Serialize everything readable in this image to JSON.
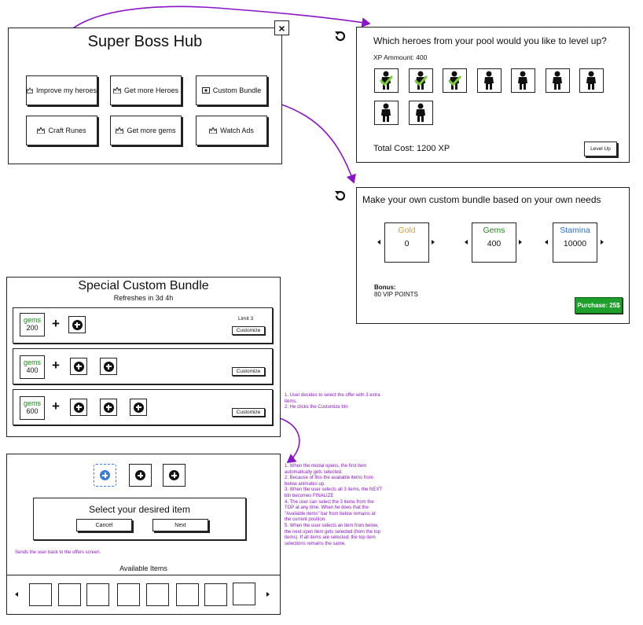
{
  "hub": {
    "title": "Super Boss Hub",
    "close_label": "×",
    "buttons": [
      {
        "label": "Improve my heroes"
      },
      {
        "label": "Get more Heroes"
      },
      {
        "label": "Custom Bundle"
      },
      {
        "label": "Craft Runes"
      },
      {
        "label": "Get more gems"
      },
      {
        "label": "Watch Ads"
      }
    ]
  },
  "levelup": {
    "question": "Which heroes from your pool would you like to level up?",
    "xp_amount": "XP Ammount: 400",
    "heroes": [
      {
        "selected": true
      },
      {
        "selected": true
      },
      {
        "selected": true
      },
      {
        "selected": false
      },
      {
        "selected": false
      },
      {
        "selected": false
      },
      {
        "selected": false
      },
      {
        "selected": false
      },
      {
        "selected": false
      }
    ],
    "total_cost": "Total Cost: 1200 XP",
    "level_up_label": "Level Up"
  },
  "custom_bundle": {
    "title": "Make your own custom bundle based on your own needs",
    "resources": [
      {
        "name": "Gold",
        "value": "0",
        "color": "#e0a020"
      },
      {
        "name": "Gems",
        "value": "400",
        "color": "#1a8a1a"
      },
      {
        "name": "Stamina",
        "value": "10000",
        "color": "#2a6fd0"
      }
    ],
    "bonus_label": "Bonus:",
    "bonus_value": "80 VIP POINTS",
    "purchase_label": "Purchase: 25$",
    "purchase_color": "#1e9e2a"
  },
  "special": {
    "title": "Special Custom Bundle",
    "subtitle": "Refreshes in 3d 4h",
    "rows": [
      {
        "gems_label": "gems",
        "gems_value": "200",
        "limit": "Limit 3",
        "customize_label": "Customize"
      },
      {
        "gems_label": "gems",
        "gems_value": "400",
        "limit": "",
        "customize_label": "Customize"
      },
      {
        "gems_label": "gems",
        "gems_value": "600",
        "limit": "",
        "customize_label": "Customize"
      }
    ],
    "plus_sign": "+"
  },
  "selector": {
    "prompt": "Select your desired item",
    "cancel_label": "Cancel",
    "next_label": "Next",
    "available_label": "Available Items",
    "cancel_note": "Sends the user back to the offers screen."
  },
  "notes": {
    "offer_note": [
      "1. User decides to select the offer with 3 extra",
      "items.",
      "2. He clicks the Customize btn"
    ],
    "modal_note": [
      "1. When the modal opens, the first item",
      "automatically gets selected.",
      "2. Because of this the available items from",
      "below animates up.",
      "3. When the user selects all 3 items, the NEXT",
      "btn becomes FINALIZE",
      "4. The user can select the 3 items from the",
      "TOP at any time. When he does that the",
      "\"Available items\" bar from below remains at",
      "the current position.",
      "5. When the user selects an item from below,",
      "the next open item gets selected (from the top",
      "items). If all items are selected, the top item",
      "selections remains the same."
    ]
  },
  "colors": {
    "annotation": "#8a14c8",
    "selected_slot": "#3a7be0"
  },
  "icons": [
    "refresh-icon",
    "hero-icon",
    "check-icon",
    "plus-circle-icon",
    "chevron-left-icon",
    "chevron-right-icon",
    "close-icon"
  ]
}
